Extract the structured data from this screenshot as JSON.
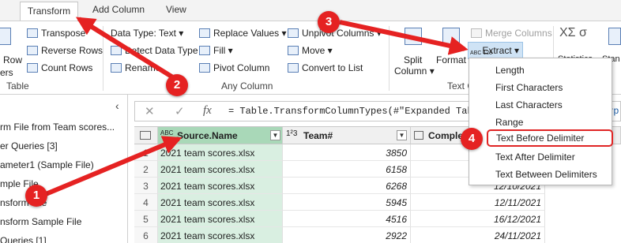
{
  "tabs": {
    "transform": "Transform",
    "add_column": "Add Column",
    "view": "View"
  },
  "ribbon": {
    "row_partial": "Row",
    "ers_partial": "ers",
    "transpose": "Transpose",
    "reverse_rows": "Reverse Rows",
    "count_rows": "Count Rows",
    "table_group": "Table",
    "data_type": "Data Type: Text",
    "detect_data_type": "Detect Data Type",
    "rename": "Rename",
    "replace_values": "Replace Values",
    "fill": "Fill",
    "pivot_column": "Pivot Column",
    "unpivot_columns": "Unpivot Columns",
    "move": "Move",
    "convert_to_list": "Convert to List",
    "any_column_group": "Any Column",
    "split_column_l1": "Split",
    "split_column_l2": "Column",
    "format": "Format",
    "merge_columns": "Merge Columns",
    "extract": "Extract",
    "text_column_group_partial": "Text C",
    "statistics_partial": "Statistics",
    "standard_partial": "Stan"
  },
  "left_pane": {
    "items": [
      "rm File from Team scores...",
      "er Queries [3]",
      "ameter1 (Sample File)",
      "mple File",
      "nsform File",
      "nsform Sample File",
      "Queries [1]"
    ]
  },
  "formula_bar": {
    "cancel": "✕",
    "confirm": "✓",
    "fx": "fx",
    "text": "= Table.TransformColumnTypes(#\"Expanded Table",
    "trailing": "yp"
  },
  "grid": {
    "headers": {
      "source_type": "ABC",
      "source": "Source.Name",
      "team_type": "1²3",
      "team": "Team#",
      "date": "Comple"
    },
    "rows": [
      {
        "idx": "1",
        "src": "2021 team scores.xlsx",
        "team": "3850",
        "date": ""
      },
      {
        "idx": "2",
        "src": "2021 team scores.xlsx",
        "team": "6158",
        "date": ""
      },
      {
        "idx": "3",
        "src": "2021 team scores.xlsx",
        "team": "6268",
        "date": "12/10/2021"
      },
      {
        "idx": "4",
        "src": "2021 team scores.xlsx",
        "team": "5945",
        "date": "12/11/2021"
      },
      {
        "idx": "5",
        "src": "2021 team scores.xlsx",
        "team": "4516",
        "date": "16/12/2021"
      },
      {
        "idx": "6",
        "src": "2021 team scores.xlsx",
        "team": "2922",
        "date": "24/11/2021"
      }
    ]
  },
  "extract_menu": {
    "items": [
      "Length",
      "First Characters",
      "Last Characters",
      "Range",
      "Text Before Delimiter",
      "Text After Delimiter",
      "Text Between Delimiters"
    ]
  },
  "annotations": {
    "b1": "1",
    "b2": "2",
    "b3": "3",
    "b4": "4"
  },
  "colors": {
    "annotation_red": "#e52222",
    "source_column_green": "#a9d8b8"
  }
}
